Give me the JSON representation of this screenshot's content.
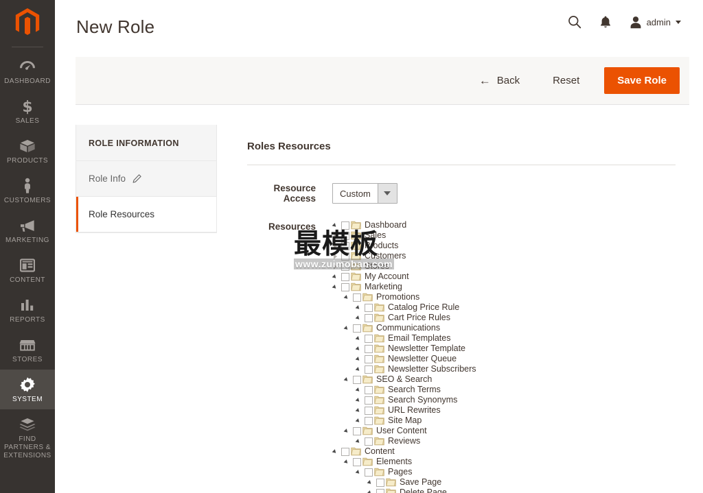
{
  "brand": {
    "logo_icon": "magento-logo-icon",
    "accent_color": "#eb5202"
  },
  "sidebar": {
    "items": [
      {
        "label": "DASHBOARD",
        "icon": "dashboard-icon",
        "active": false
      },
      {
        "label": "SALES",
        "icon": "dollar-icon",
        "active": false
      },
      {
        "label": "PRODUCTS",
        "icon": "box-icon",
        "active": false
      },
      {
        "label": "CUSTOMERS",
        "icon": "person-icon",
        "active": false
      },
      {
        "label": "MARKETING",
        "icon": "megaphone-icon",
        "active": false
      },
      {
        "label": "CONTENT",
        "icon": "layout-icon",
        "active": false
      },
      {
        "label": "REPORTS",
        "icon": "bar-chart-icon",
        "active": false
      },
      {
        "label": "STORES",
        "icon": "storefront-icon",
        "active": false
      },
      {
        "label": "SYSTEM",
        "icon": "gear-icon",
        "active": true
      },
      {
        "label": "FIND PARTNERS & EXTENSIONS",
        "icon": "extension-icon",
        "active": false
      }
    ]
  },
  "header": {
    "title": "New Role",
    "search_icon": "search-icon",
    "notifications_icon": "bell-icon",
    "user_icon": "user-avatar-icon",
    "user_name": "admin",
    "caret_icon": "chevron-down-icon"
  },
  "action_bar": {
    "back_label": "Back",
    "back_icon": "arrow-left-icon",
    "reset_label": "Reset",
    "save_label": "Save Role"
  },
  "left_panel": {
    "heading": "ROLE INFORMATION",
    "items": [
      {
        "label": "Role Info",
        "icon": "pencil-icon",
        "current": false
      },
      {
        "label": "Role Resources",
        "icon": "",
        "current": true
      }
    ]
  },
  "main": {
    "section_title": "Roles Resources",
    "resource_access": {
      "label": "Resource Access",
      "value": "Custom",
      "arrow_icon": "chevron-down-icon"
    },
    "resources_label": "Resources",
    "tree": [
      {
        "depth": 0,
        "label": "Dashboard",
        "expanded": true,
        "checked": false
      },
      {
        "depth": 0,
        "label": "Sales",
        "expanded": false,
        "checked": false
      },
      {
        "depth": 0,
        "label": "Products",
        "expanded": false,
        "checked": false
      },
      {
        "depth": 0,
        "label": "Customers",
        "expanded": false,
        "checked": false
      },
      {
        "depth": 0,
        "label": "Stores",
        "expanded": false,
        "checked": false
      },
      {
        "depth": 0,
        "label": "My Account",
        "expanded": true,
        "checked": false
      },
      {
        "depth": 0,
        "label": "Marketing",
        "expanded": true,
        "checked": false
      },
      {
        "depth": 1,
        "label": "Promotions",
        "expanded": true,
        "checked": false
      },
      {
        "depth": 2,
        "label": "Catalog Price Rule",
        "expanded": true,
        "checked": false
      },
      {
        "depth": 2,
        "label": "Cart Price Rules",
        "expanded": true,
        "checked": false
      },
      {
        "depth": 1,
        "label": "Communications",
        "expanded": true,
        "checked": false
      },
      {
        "depth": 2,
        "label": "Email Templates",
        "expanded": true,
        "checked": false
      },
      {
        "depth": 2,
        "label": "Newsletter Template",
        "expanded": true,
        "checked": false
      },
      {
        "depth": 2,
        "label": "Newsletter Queue",
        "expanded": true,
        "checked": false
      },
      {
        "depth": 2,
        "label": "Newsletter Subscribers",
        "expanded": true,
        "checked": false
      },
      {
        "depth": 1,
        "label": "SEO & Search",
        "expanded": true,
        "checked": false
      },
      {
        "depth": 2,
        "label": "Search Terms",
        "expanded": true,
        "checked": false
      },
      {
        "depth": 2,
        "label": "Search Synonyms",
        "expanded": true,
        "checked": false
      },
      {
        "depth": 2,
        "label": "URL Rewrites",
        "expanded": true,
        "checked": false
      },
      {
        "depth": 2,
        "label": "Site Map",
        "expanded": true,
        "checked": false
      },
      {
        "depth": 1,
        "label": "User Content",
        "expanded": true,
        "checked": false
      },
      {
        "depth": 2,
        "label": "Reviews",
        "expanded": true,
        "checked": false
      },
      {
        "depth": 0,
        "label": "Content",
        "expanded": true,
        "checked": false
      },
      {
        "depth": 1,
        "label": "Elements",
        "expanded": true,
        "checked": false
      },
      {
        "depth": 2,
        "label": "Pages",
        "expanded": true,
        "checked": false
      },
      {
        "depth": 3,
        "label": "Save Page",
        "expanded": true,
        "checked": false
      },
      {
        "depth": 3,
        "label": "Delete Page",
        "expanded": true,
        "checked": false
      }
    ]
  },
  "watermark": {
    "chinese": "最模板",
    "url": "www.zuimoban.com"
  }
}
